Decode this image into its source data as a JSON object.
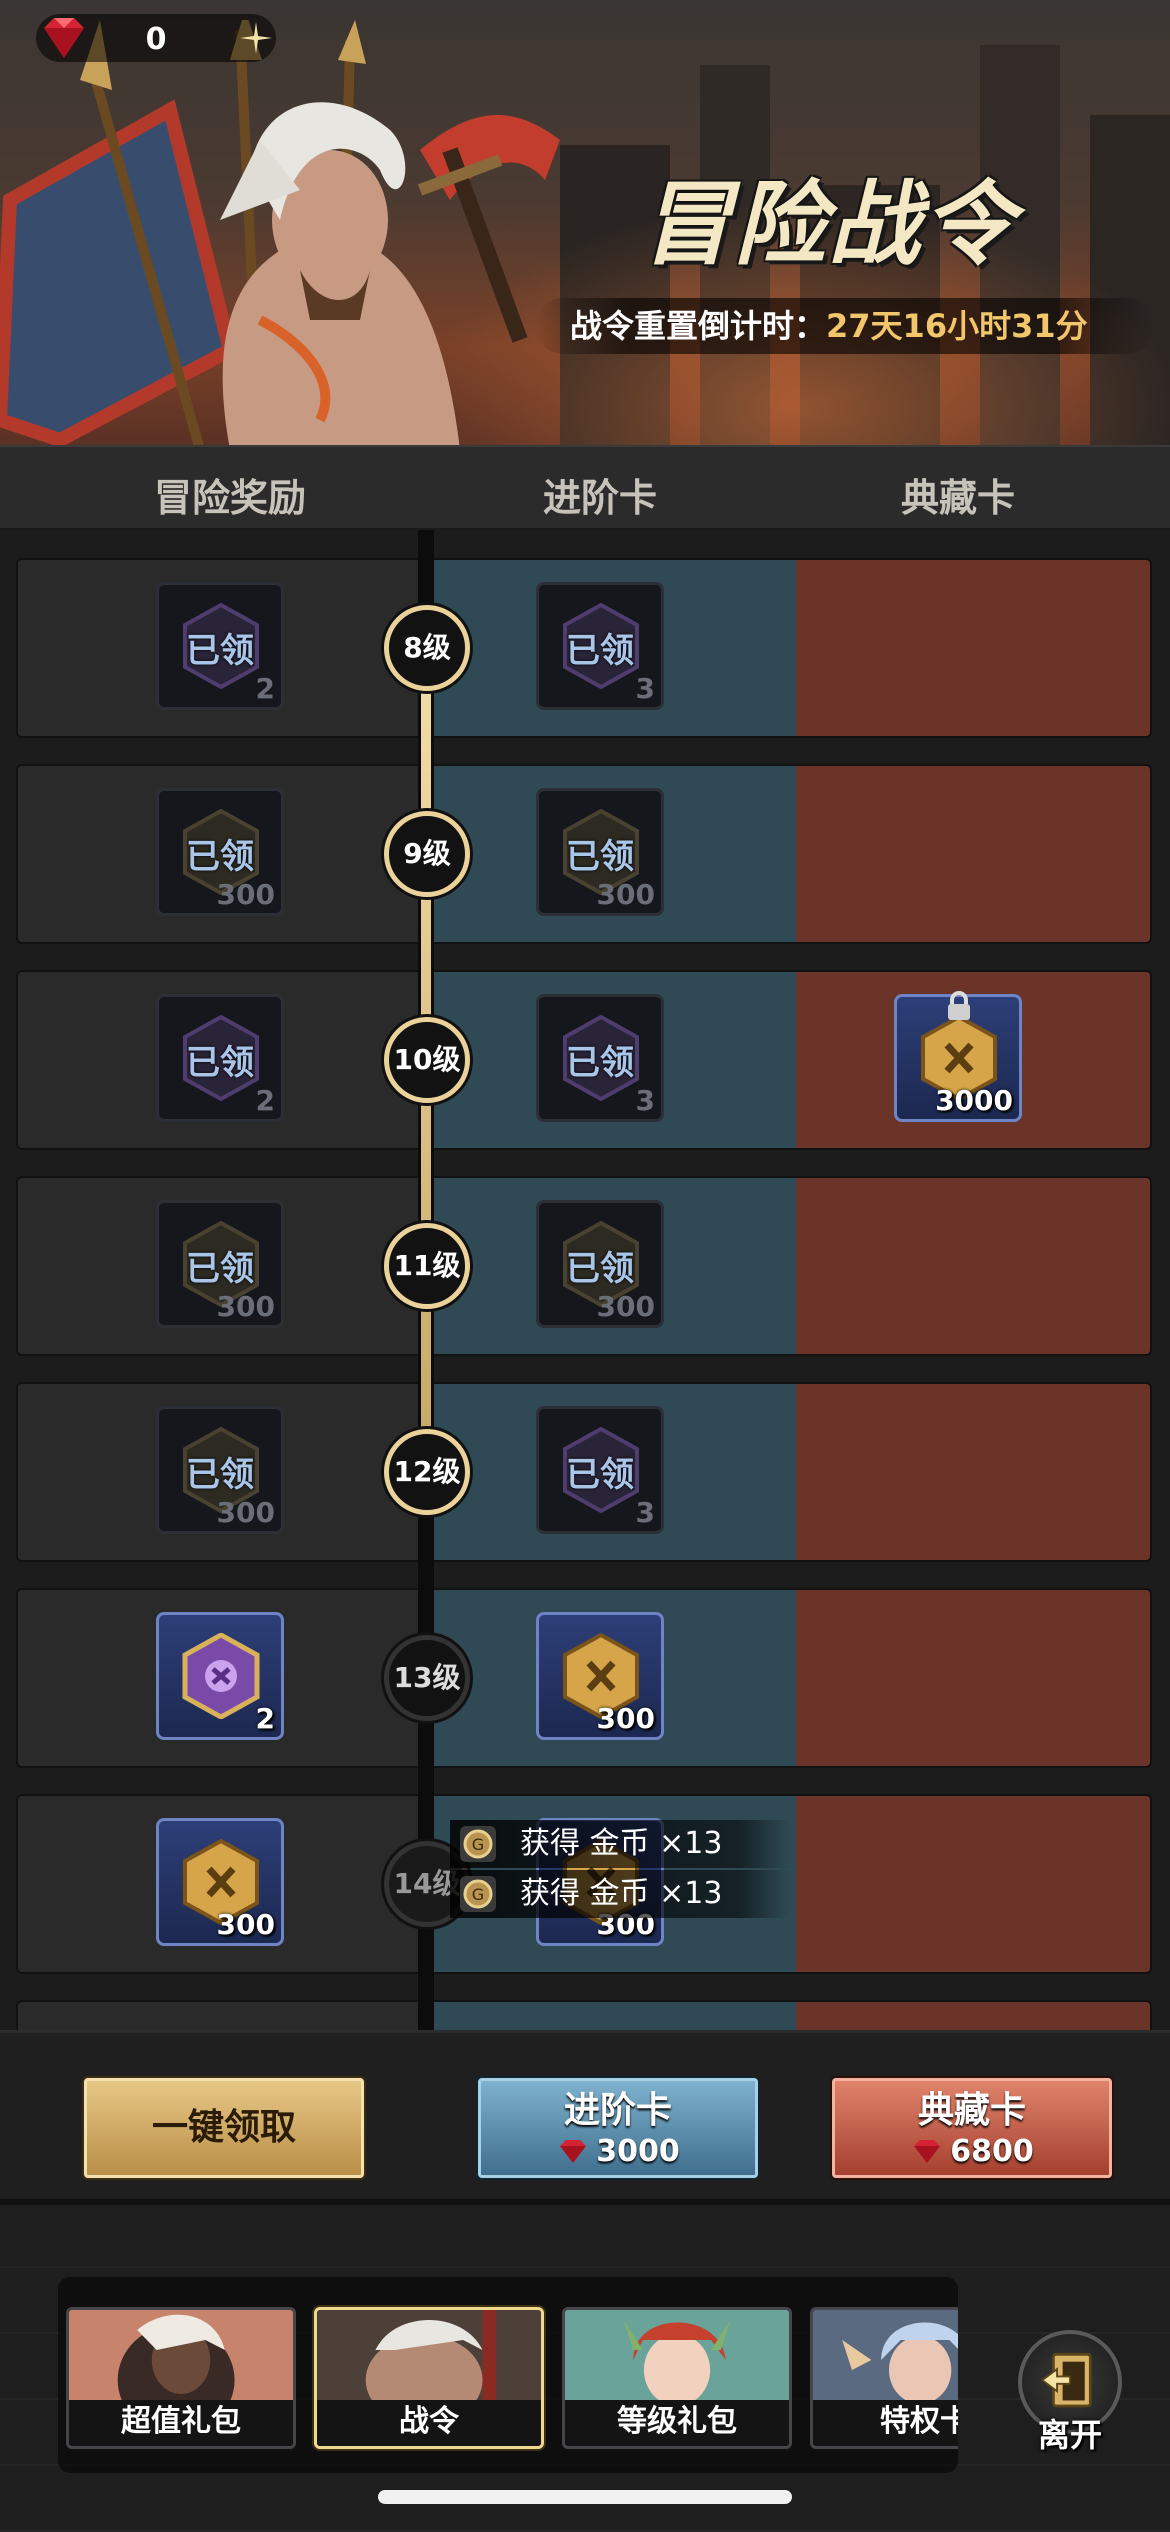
{
  "header": {
    "gem_count": "0",
    "title": "冒险战令",
    "countdown_label": "战令重置倒计时：",
    "countdown_value": "27天16小时31分"
  },
  "columns": [
    "冒险奖励",
    "进阶卡",
    "典藏卡"
  ],
  "claimed_label": "已领",
  "rows": [
    {
      "level": "8级",
      "free_qty": "2",
      "adv_qty": "3",
      "free_claimed": true,
      "adv_claimed": true
    },
    {
      "level": "9级",
      "free_qty": "300",
      "adv_qty": "300",
      "free_claimed": true,
      "adv_claimed": true
    },
    {
      "level": "10级",
      "free_qty": "2",
      "adv_qty": "3",
      "coll_qty": "3000",
      "free_claimed": true,
      "adv_claimed": true,
      "coll_locked": true
    },
    {
      "level": "11级",
      "free_qty": "300",
      "adv_qty": "300",
      "free_claimed": true,
      "adv_claimed": true
    },
    {
      "level": "12级",
      "free_qty": "300",
      "adv_qty": "3",
      "free_claimed": true,
      "adv_claimed": true
    },
    {
      "level": "13级",
      "free_qty": "2",
      "adv_qty": "300",
      "free_claimed": false,
      "adv_claimed": false
    },
    {
      "level": "14级",
      "free_qty": "300",
      "adv_qty": "300",
      "free_claimed": false,
      "adv_claimed": false
    }
  ],
  "toasts": [
    {
      "text": "获得 金币",
      "mult": "×13"
    },
    {
      "text": "获得 金币",
      "mult": "×13"
    }
  ],
  "actions": {
    "claim_all": "一键领取",
    "advanced": {
      "label": "进阶卡",
      "price": "3000"
    },
    "collector": {
      "label": "典藏卡",
      "price": "6800"
    }
  },
  "tabs": [
    "超值礼包",
    "战令",
    "等级礼包",
    "特权卡"
  ],
  "active_tab": "战令",
  "leave_label": "离开",
  "colors": {
    "gold_accent": "#ead29a",
    "price_gold": "#f2c66b",
    "advanced_col": "#2f4a55",
    "collector_col": "#6a3429"
  }
}
